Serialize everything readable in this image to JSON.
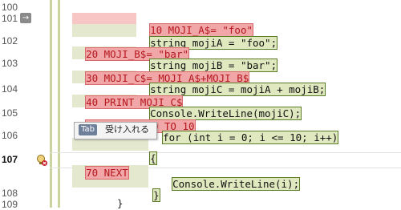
{
  "gutter": {
    "line_numbers": [
      "100",
      "101",
      "102",
      "103",
      "104",
      "105",
      "106",
      "107",
      "108",
      "109"
    ],
    "current_line": "107",
    "arrow_icon": "→"
  },
  "code": {
    "line101_old": "10 MOJI_A$= \"foo\"",
    "line101_new": "string mojiA = \"foo\";",
    "line102_old": "20 MOJI_B$= \"bar\"",
    "line102_new": "string mojiB = \"bar\";",
    "line103_old": "30 MOJI_C$= MOJI_A$+MOJI_B$",
    "line103_new": "string mojiC = mojiA + mojiB;",
    "line104_old": "40 PRINT MOJI_C$",
    "line104_new": "Console.WriteLine(mojiC);",
    "line105_old": "50 FOR I = 0 TO 10",
    "line105_new": "for (int i = 0; i <= 10; i++)",
    "line106_new": "{",
    "line107_old": "70 NEXT",
    "line107_new": "Console.WriteLine(i);",
    "line107_close": "}",
    "line109": "}"
  },
  "tooltip": {
    "key": "Tab",
    "label": "受け入れる"
  },
  "colors": {
    "removed": "#f1a7a7",
    "added": "#dfe8be",
    "change_bar": "#c9d49e"
  }
}
